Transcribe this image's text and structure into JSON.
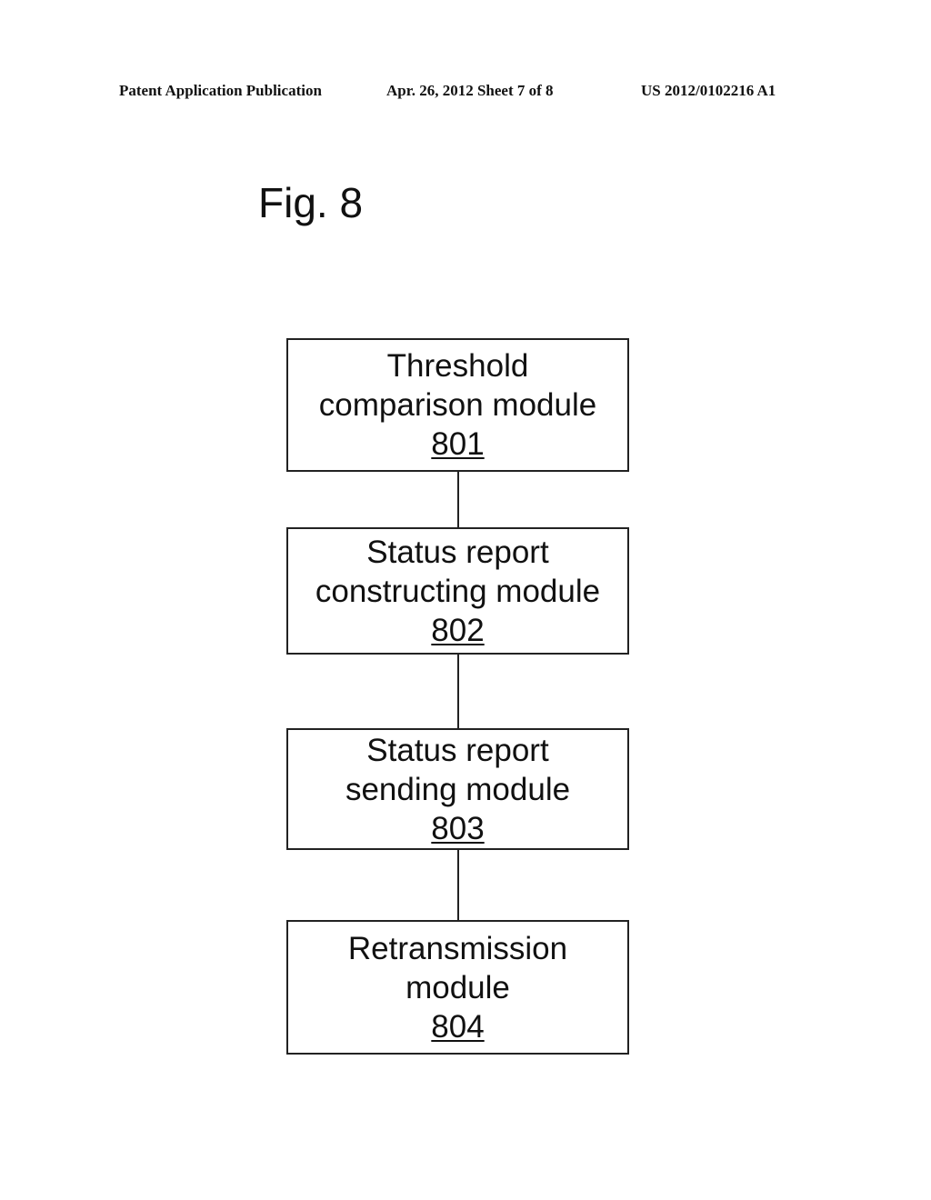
{
  "header": {
    "left": "Patent Application Publication",
    "middle": "Apr. 26, 2012  Sheet 7 of 8",
    "right": "US 2012/0102216 A1"
  },
  "figure": {
    "label": "Fig. 8",
    "modules": [
      {
        "lines": [
          "Threshold",
          "comparison module"
        ],
        "ref": "801"
      },
      {
        "lines": [
          "Status report",
          "constructing module"
        ],
        "ref": "802"
      },
      {
        "lines": [
          "Status report",
          "sending module"
        ],
        "ref": "803"
      },
      {
        "lines": [
          "Retransmission",
          "module"
        ],
        "ref": "804"
      }
    ]
  }
}
